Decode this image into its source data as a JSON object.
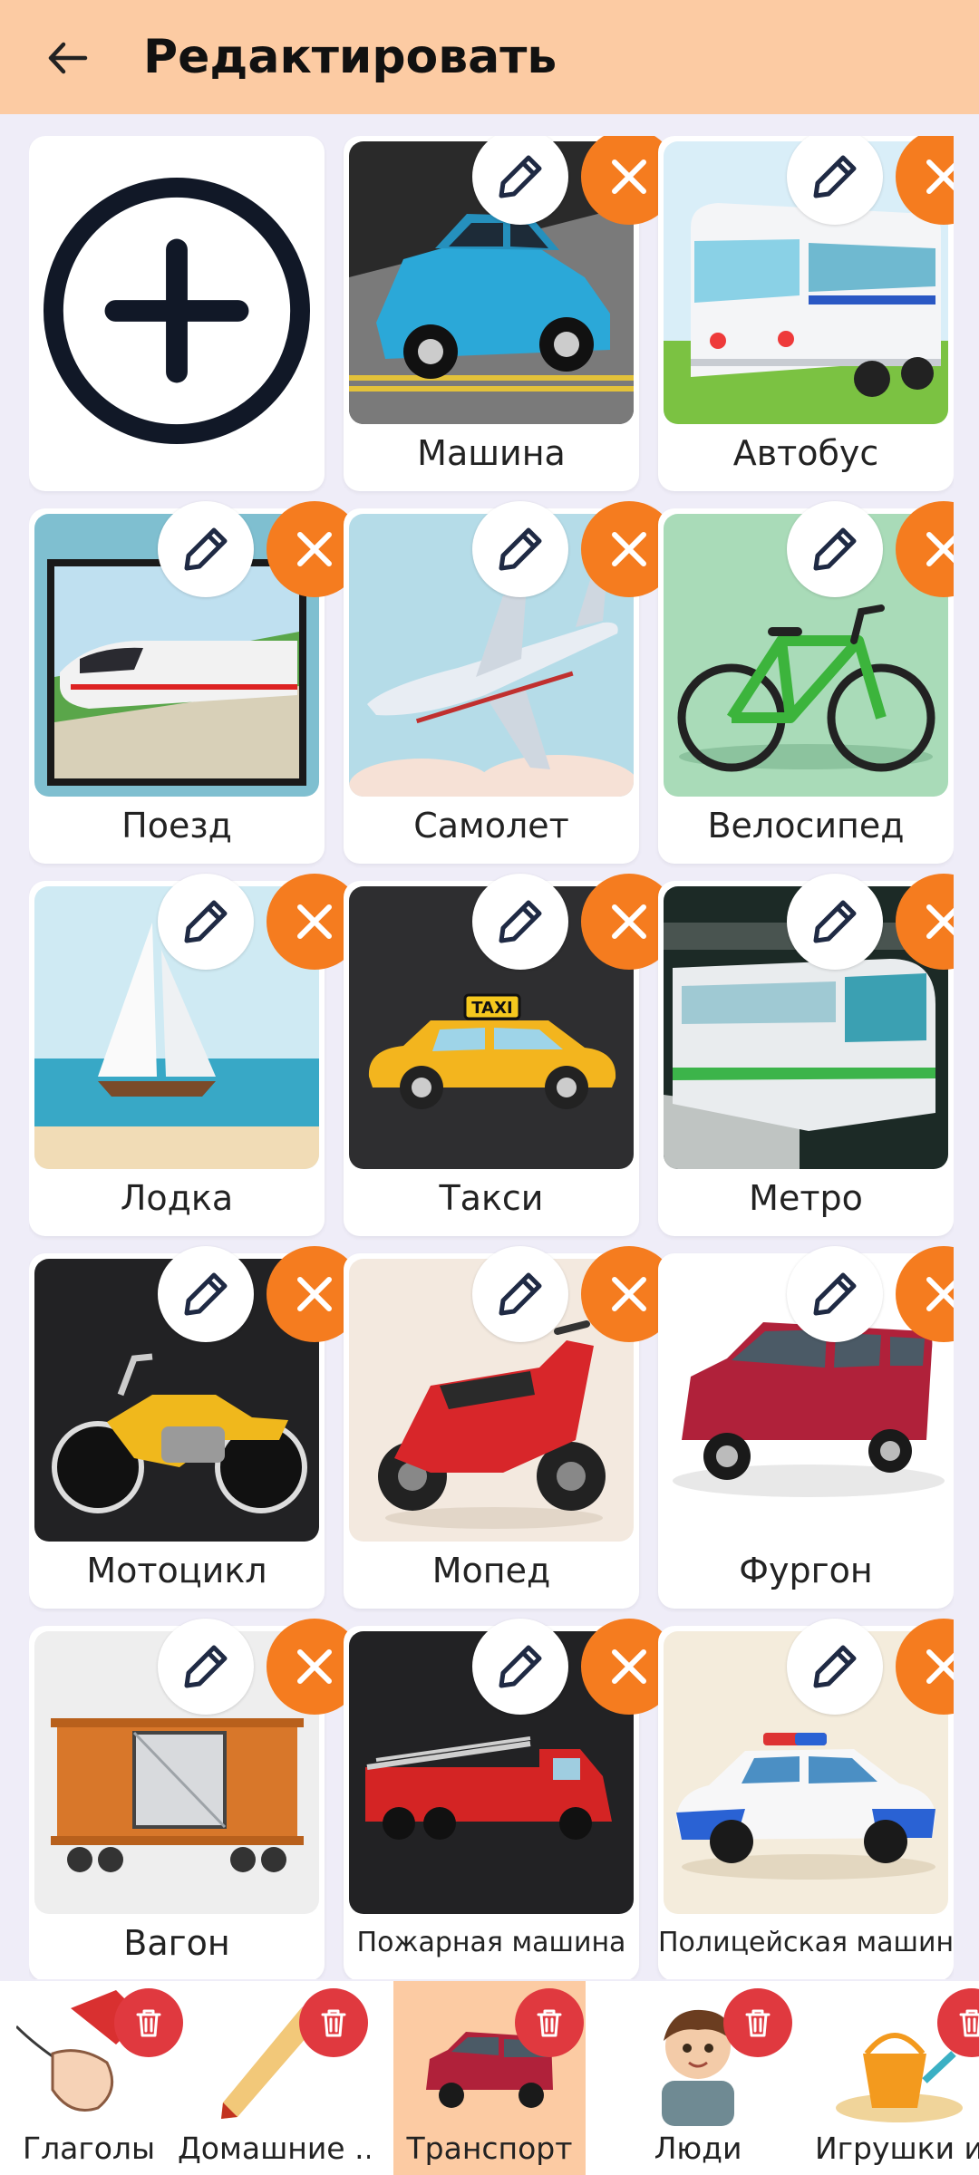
{
  "header": {
    "title": "Редактировать",
    "back_icon": "arrow-left-icon",
    "background": "#fccba3"
  },
  "colors": {
    "edit_button": "#ffffff",
    "delete_button": "#f57c1f",
    "category_delete": "#e0393f",
    "active_category": "#fccba3"
  },
  "add_card": {
    "icon": "plus-circle-icon"
  },
  "cards": [
    {
      "label": "Машина",
      "picture": "car"
    },
    {
      "label": "Автобус",
      "picture": "bus"
    },
    {
      "label": "Поезд",
      "picture": "train"
    },
    {
      "label": "Самолет",
      "picture": "airplane"
    },
    {
      "label": "Велосипед",
      "picture": "bicycle"
    },
    {
      "label": "Лодка",
      "picture": "sailboat"
    },
    {
      "label": "Такси",
      "picture": "taxi"
    },
    {
      "label": "Метро",
      "picture": "metro"
    },
    {
      "label": "Мотоцикл",
      "picture": "motorcycle"
    },
    {
      "label": "Мопед",
      "picture": "moped"
    },
    {
      "label": "Фургон",
      "picture": "van"
    },
    {
      "label": "Вагон",
      "picture": "freight-car"
    },
    {
      "label": "Пожарная машина",
      "picture": "fire-truck"
    },
    {
      "label": "Полицейская машина",
      "picture": "police-car"
    }
  ],
  "card_actions": {
    "edit_icon": "pencil-icon",
    "delete_icon": "close-icon"
  },
  "categories": [
    {
      "label": "Глаголы",
      "picture": "holding-hands",
      "active": false
    },
    {
      "label": "Домашние ...",
      "picture": "pencil",
      "active": false
    },
    {
      "label": "Транспорт",
      "picture": "van",
      "active": true
    },
    {
      "label": "Люди",
      "picture": "boy",
      "active": false
    },
    {
      "label": "Игрушки и",
      "picture": "bucket",
      "active": false
    }
  ],
  "category_action": {
    "delete_icon": "trash-icon"
  }
}
